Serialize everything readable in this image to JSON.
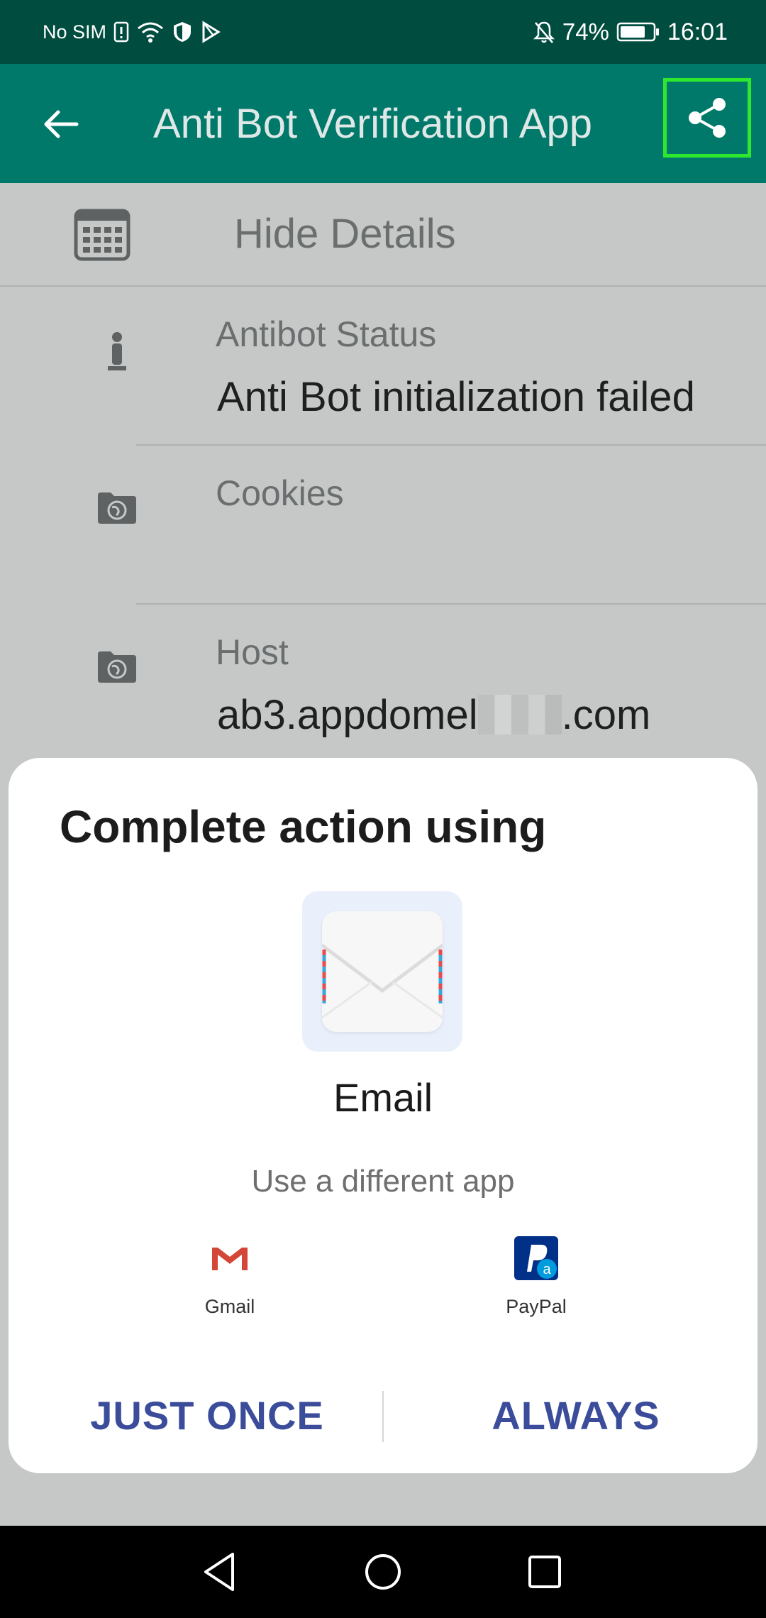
{
  "status_bar": {
    "carrier": "No SIM",
    "battery_percent": "74%",
    "time": "16:01"
  },
  "app_bar": {
    "title": "Anti Bot Verification App",
    "back_icon": "arrow-left-icon",
    "share_icon": "share-icon"
  },
  "details_toggle": {
    "label": "Hide Details",
    "icon": "calendar-grid-icon"
  },
  "details": [
    {
      "label": "Antibot Status",
      "value": "Anti Bot initialization failed",
      "icon": "person-icon"
    },
    {
      "label": "Cookies",
      "value": "",
      "icon": "folder-globe-icon"
    },
    {
      "label": "Host",
      "value_prefix": "ab3.appdomel",
      "value_suffix": ".com",
      "icon": "folder-globe-icon"
    }
  ],
  "chooser": {
    "title": "Complete action using",
    "primary_app": "Email",
    "different_app_label": "Use a different app",
    "apps": [
      {
        "name": "Gmail",
        "icon": "gmail-icon"
      },
      {
        "name": "PayPal",
        "icon": "paypal-icon"
      }
    ],
    "just_once_label": "JUST ONCE",
    "always_label": "ALWAYS"
  },
  "colors": {
    "status_bar": "#004d40",
    "app_bar": "#00796b",
    "highlight": "#2ee82e",
    "button_text": "#3b4c9a"
  }
}
